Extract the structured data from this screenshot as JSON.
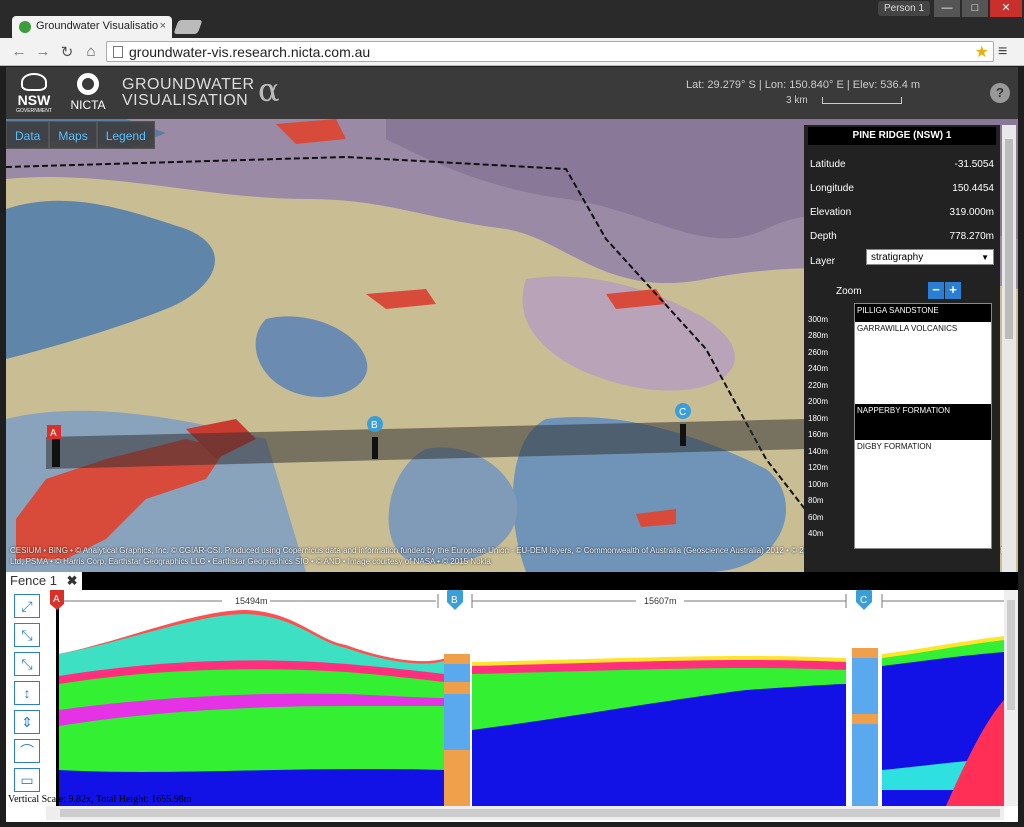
{
  "browser": {
    "tab_title": "Groundwater Visualisatio",
    "tab_close": "×",
    "user": "Person 1",
    "url": "groundwater-vis.research.nicta.com.au",
    "min": "—",
    "max": "□",
    "close": "✕"
  },
  "app": {
    "nsw_logo": "NSW",
    "nsw_gov": "GOVERNMENT",
    "nicta_logo": "NICTA",
    "title_line1": "GROUNDWATER",
    "title_line2": "VISUALISATION",
    "alpha": "α",
    "coords": "Lat: 29.279° S  |  Lon: 150.840° E  |  Elev: 536.4 m",
    "scale_label": "3 km",
    "help": "?"
  },
  "map": {
    "buttons": [
      "Data",
      "Maps",
      "Legend"
    ],
    "markers": [
      "A",
      "B",
      "C"
    ],
    "attribution": "CESIUM • BING • © Analytical Graphics, Inc. © CGIAR-CSI. Produced using Copernicus data and information funded by the European Union - EU-DEM layers, © Commonwealth of Australia (Geoscience Australia) 2012 • © 2015 Microsoft Corporation • © 2015 MapData Sciences Pty Ltd, PSMA • © Harris Corp, Earthstar Geographics LLC • Earthstar Geographics SIO • © AND • Image courtesy of NASA • © 2015 Nokia"
  },
  "panel": {
    "title": "PINE RIDGE (NSW) 1",
    "rows": [
      {
        "label": "Latitude",
        "value": "-31.5054"
      },
      {
        "label": "Longitude",
        "value": "150.4454"
      },
      {
        "label": "Elevation",
        "value": "319.000m"
      },
      {
        "label": "Depth",
        "value": "778.270m"
      }
    ],
    "layer_label": "Layer",
    "layer_value": "stratigraphy",
    "zoom_label": "Zoom",
    "zoom_minus": "−",
    "zoom_plus": "+",
    "depths": [
      "300m",
      "280m",
      "260m",
      "240m",
      "220m",
      "200m",
      "180m",
      "160m",
      "140m",
      "120m",
      "100m",
      "80m",
      "60m",
      "40m"
    ],
    "layers": [
      "PILLIGA SANDSTONE",
      "GARRAWILLA VOLCANICS",
      "NAPPERBY FORMATION",
      "DIGBY FORMATION"
    ]
  },
  "fence": {
    "tab_label": "Fence 1",
    "tab_close": "✖",
    "segment1": "15494m",
    "segment2": "15607m",
    "marker_labels": [
      "A",
      "B",
      "C"
    ],
    "vertical_scale": "Vertical Scale: 9.82x, Total Height: 1655.98m"
  },
  "colors": {
    "accent": "#2a7fd4",
    "marker_red": "#d9302a",
    "marker_blue": "#3a9fd8"
  }
}
